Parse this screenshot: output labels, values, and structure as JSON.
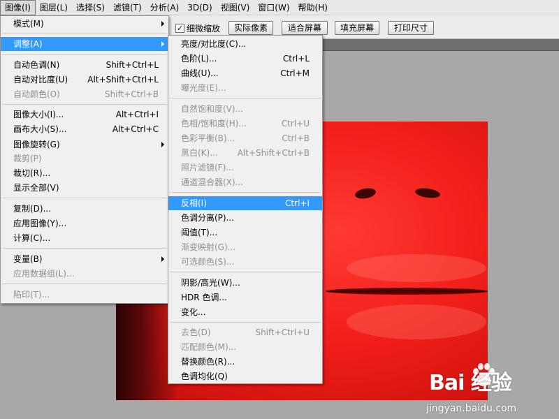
{
  "menubar": {
    "items": [
      "图像(I)",
      "图层(L)",
      "选择(S)",
      "滤镜(T)",
      "分析(A)",
      "3D(D)",
      "视图(V)",
      "窗口(W)",
      "帮助(H)"
    ]
  },
  "optbar": {
    "checkbox_label": "细微缩放",
    "checkbox_checked": true,
    "buttons": [
      "实际像素",
      "适合屏幕",
      "填充屏幕",
      "打印尺寸"
    ]
  },
  "image_menu": {
    "items": [
      {
        "label": "模式(M)",
        "shortcut": "",
        "disabled": false,
        "submenu": true
      },
      {
        "label": "调整(A)",
        "shortcut": "",
        "disabled": false,
        "submenu": true,
        "highlighted": true
      },
      {
        "label": "自动色调(N)",
        "shortcut": "Shift+Ctrl+L",
        "disabled": false
      },
      {
        "label": "自动对比度(U)",
        "shortcut": "Alt+Shift+Ctrl+L",
        "disabled": false
      },
      {
        "label": "自动颜色(O)",
        "shortcut": "Shift+Ctrl+B",
        "disabled": true
      },
      {
        "label": "图像大小(I)...",
        "shortcut": "Alt+Ctrl+I",
        "disabled": false
      },
      {
        "label": "画布大小(S)...",
        "shortcut": "Alt+Ctrl+C",
        "disabled": false
      },
      {
        "label": "图像旋转(G)",
        "shortcut": "",
        "disabled": false,
        "submenu": true
      },
      {
        "label": "裁剪(P)",
        "shortcut": "",
        "disabled": true
      },
      {
        "label": "裁切(R)...",
        "shortcut": "",
        "disabled": false
      },
      {
        "label": "显示全部(V)",
        "shortcut": "",
        "disabled": false
      },
      {
        "label": "复制(D)...",
        "shortcut": "",
        "disabled": false
      },
      {
        "label": "应用图像(Y)...",
        "shortcut": "",
        "disabled": false
      },
      {
        "label": "计算(C)...",
        "shortcut": "",
        "disabled": false
      },
      {
        "label": "变量(B)",
        "shortcut": "",
        "disabled": false,
        "submenu": true
      },
      {
        "label": "应用数据组(L)...",
        "shortcut": "",
        "disabled": true
      },
      {
        "label": "陷印(T)...",
        "shortcut": "",
        "disabled": true
      }
    ]
  },
  "adjust_menu": {
    "items": [
      {
        "label": "亮度/对比度(C)...",
        "shortcut": "",
        "disabled": false
      },
      {
        "label": "色阶(L)...",
        "shortcut": "Ctrl+L",
        "disabled": false
      },
      {
        "label": "曲线(U)...",
        "shortcut": "Ctrl+M",
        "disabled": false
      },
      {
        "label": "曝光度(E)...",
        "shortcut": "",
        "disabled": true
      },
      {
        "label": "自然饱和度(V)...",
        "shortcut": "",
        "disabled": true
      },
      {
        "label": "色相/饱和度(H)...",
        "shortcut": "Ctrl+U",
        "disabled": true
      },
      {
        "label": "色彩平衡(B)...",
        "shortcut": "Ctrl+B",
        "disabled": true
      },
      {
        "label": "黑白(K)...",
        "shortcut": "Alt+Shift+Ctrl+B",
        "disabled": true
      },
      {
        "label": "照片滤镜(F)...",
        "shortcut": "",
        "disabled": true
      },
      {
        "label": "通道混合器(X)...",
        "shortcut": "",
        "disabled": true
      },
      {
        "label": "反相(I)",
        "shortcut": "Ctrl+I",
        "disabled": false,
        "highlighted": true
      },
      {
        "label": "色调分离(P)...",
        "shortcut": "",
        "disabled": false
      },
      {
        "label": "阈值(T)...",
        "shortcut": "",
        "disabled": false
      },
      {
        "label": "渐变映射(G)...",
        "shortcut": "",
        "disabled": true
      },
      {
        "label": "可选颜色(S)...",
        "shortcut": "",
        "disabled": true
      },
      {
        "label": "阴影/高光(W)...",
        "shortcut": "",
        "disabled": false
      },
      {
        "label": "HDR 色调...",
        "shortcut": "",
        "disabled": false
      },
      {
        "label": "变化...",
        "shortcut": "",
        "disabled": false
      },
      {
        "label": "去色(D)",
        "shortcut": "Shift+Ctrl+U",
        "disabled": true
      },
      {
        "label": "匹配颜色(M)...",
        "shortcut": "",
        "disabled": true
      },
      {
        "label": "替换颜色(R)...",
        "shortcut": "",
        "disabled": false
      },
      {
        "label": "色调均化(Q)",
        "shortcut": "",
        "disabled": false
      }
    ]
  },
  "watermark": {
    "brand": "Bai 经验",
    "url": "jingyan.baidu.com"
  },
  "colors": {
    "highlight": "#3399ff",
    "disabled_text": "#8f8f8f",
    "canvas_red": "#f21e1a"
  }
}
